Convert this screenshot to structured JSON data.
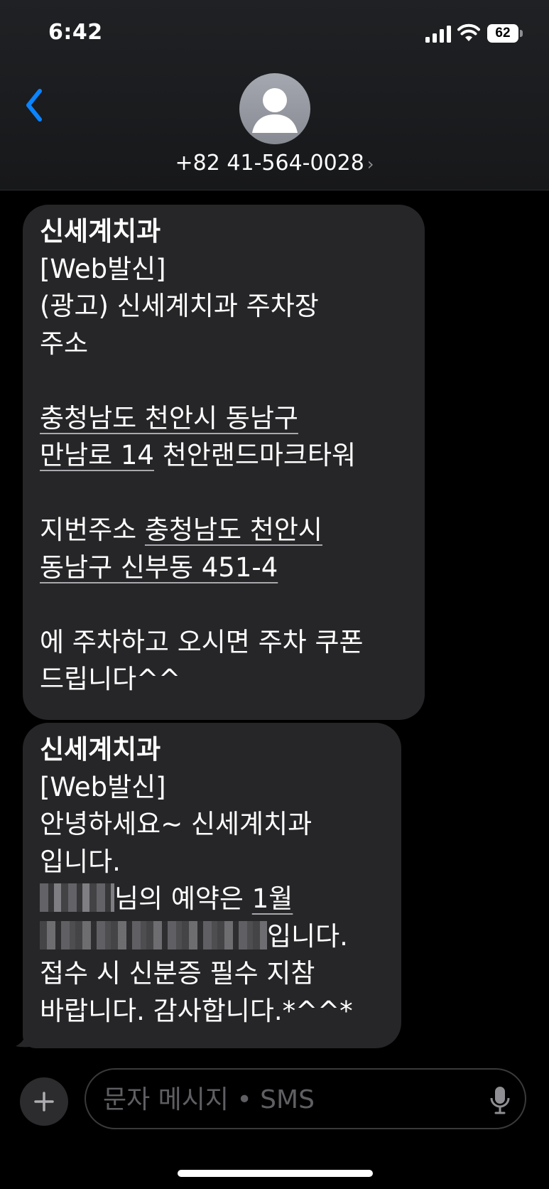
{
  "status_bar": {
    "time": "6:42",
    "battery_level": "62"
  },
  "header": {
    "contact": "+82 41-564-0028",
    "contact_chevron": "›"
  },
  "messages": [
    {
      "lines": [
        {
          "parts": [
            {
              "text": "신세계치과",
              "style": "bold"
            }
          ]
        },
        {
          "parts": [
            {
              "text": "[Web발신]"
            }
          ]
        },
        {
          "parts": [
            {
              "text": "(광고) 신세계치과 주차장"
            }
          ]
        },
        {
          "parts": [
            {
              "text": "주소"
            }
          ]
        },
        {
          "parts": []
        },
        {
          "parts": [
            {
              "text": "충청남도 천안시 동남구",
              "style": "underline"
            }
          ]
        },
        {
          "parts": [
            {
              "text": "만남로 14",
              "style": "underline"
            },
            {
              "text": " 천안랜드마크타워"
            }
          ]
        },
        {
          "parts": []
        },
        {
          "parts": [
            {
              "text": "지번주소 "
            },
            {
              "text": "충청남도 천안시",
              "style": "underline"
            }
          ]
        },
        {
          "parts": [
            {
              "text": "동남구 신부동 451-4",
              "style": "underline"
            }
          ]
        },
        {
          "parts": []
        },
        {
          "parts": [
            {
              "text": "에 주차하고 오시면 주차 쿠폰"
            }
          ]
        },
        {
          "parts": [
            {
              "text": "드립니다^^"
            }
          ]
        }
      ]
    },
    {
      "lines": [
        {
          "parts": [
            {
              "text": "신세계치과",
              "style": "bold"
            }
          ]
        },
        {
          "parts": [
            {
              "text": "[Web발신]"
            }
          ]
        },
        {
          "parts": [
            {
              "text": "안녕하세요~ 신세계치과"
            }
          ]
        },
        {
          "parts": [
            {
              "text": "입니다."
            }
          ]
        },
        {
          "parts": [
            {
              "redacted": true,
              "variant": "a"
            },
            {
              "text": "님의 예약은 "
            },
            {
              "text": "1월",
              "style": "underline"
            }
          ]
        },
        {
          "parts": [
            {
              "redacted": true,
              "variant": "b"
            },
            {
              "text": "입니다."
            }
          ]
        },
        {
          "parts": [
            {
              "text": "접수 시 신분증 필수 지참"
            }
          ]
        },
        {
          "parts": [
            {
              "text": "바랍니다. 감사합니다.*^^*"
            }
          ]
        }
      ]
    }
  ],
  "composer": {
    "placeholder": "문자 메시지 • SMS"
  },
  "icons": {
    "back": "chevron-left-icon",
    "avatar": "person-icon",
    "plus": "plus-icon",
    "mic": "microphone-icon",
    "signal": "signal-icon",
    "wifi": "wifi-icon",
    "battery": "battery-icon"
  },
  "colors": {
    "accent": "#0a84ff",
    "bubble": "#262628",
    "background": "#000000"
  }
}
